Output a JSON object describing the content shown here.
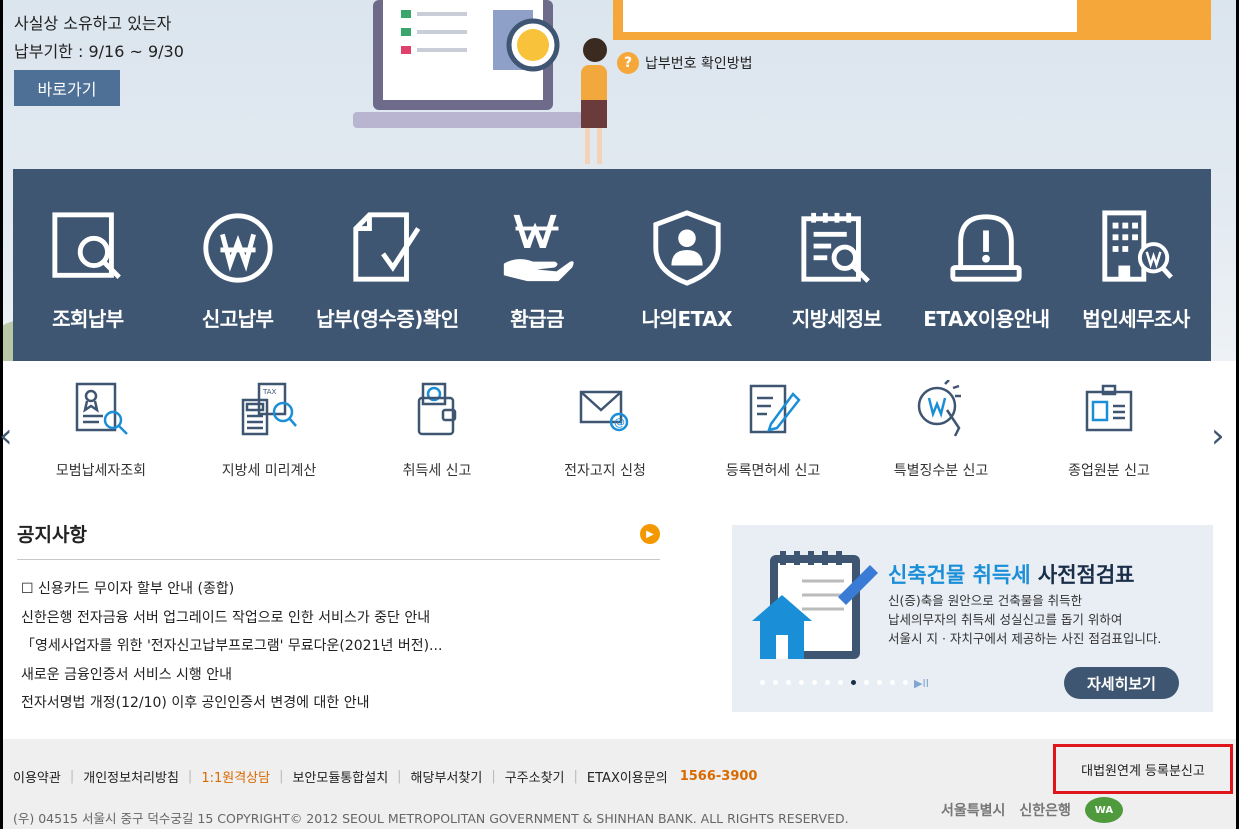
{
  "hero": {
    "line1": "사실상 소유하고 있는자",
    "line2": "납부기한 : 9/16 ~ 9/30",
    "button": "바로가기",
    "help": "납부번호 확인방법"
  },
  "main_menu": [
    {
      "label": "조회납부",
      "icon": "search-document-icon"
    },
    {
      "label": "신고납부",
      "icon": "won-coin-icon"
    },
    {
      "label": "납부(영수증)확인",
      "icon": "document-check-icon"
    },
    {
      "label": "환급금",
      "icon": "refund-hand-icon"
    },
    {
      "label": "나의ETAX",
      "icon": "user-shield-icon"
    },
    {
      "label": "지방세정보",
      "icon": "info-document-icon"
    },
    {
      "label": "ETAX이용안내",
      "icon": "alert-bell-icon"
    },
    {
      "label": "법인세무조사",
      "icon": "building-won-icon"
    }
  ],
  "sub_menu": [
    {
      "label": "모범납세자조회",
      "icon": "award-search-icon"
    },
    {
      "label": "지방세 미리계산",
      "icon": "calculator-icon"
    },
    {
      "label": "취득세 신고",
      "icon": "wallet-icon"
    },
    {
      "label": "전자고지 신청",
      "icon": "email-icon"
    },
    {
      "label": "등록면허세 신고",
      "icon": "form-pen-icon"
    },
    {
      "label": "특별징수분 신고",
      "icon": "won-touch-icon"
    },
    {
      "label": "종업원분 신고",
      "icon": "id-card-icon"
    }
  ],
  "notice": {
    "title": "공지사항",
    "items": [
      "☐ 신용카드 무이자 할부 안내 (종합)",
      "신한은행 전자금융 서버 업그레이드 작업으로 인한 서비스가 중단 안내",
      "「영세사업자를 위한 '전자신고납부프로그램' 무료다운(2021년 버전)...",
      "새로운 금융인증서 서비스 시행 안내",
      "전자서명법 개정(12/10) 이후 공인인증서 변경에 대한 안내"
    ]
  },
  "banner": {
    "title_highlight": "신축건물 취득세",
    "title_rest": " 사전점검표",
    "desc1": "신(증)축을 원안으로 건축물을 취득한",
    "desc2": "납세의무자의 취득세 성실신고를 돕기 위하여",
    "desc3": "서울시 지 · 자치구에서 제공하는 사진 점검표입니다.",
    "button": "자세히보기",
    "play": "▶II"
  },
  "footer": {
    "links": [
      "이용약관",
      "개인정보처리방침",
      "1:1원격상담",
      "보안모듈통합설치",
      "해당부서찾기",
      "구주소찾기",
      "ETAX이용문의"
    ],
    "phone": "1566-3900",
    "court": "대법원연계 등록분신고",
    "copyright": "(우) 04515 서울시 중구 덕수궁길 15 COPYRIGHT© 2012 SEOUL METROPOLITAN GOVERNMENT & SHINHAN BANK. ALL RIGHTS RESERVED.",
    "logo_seoul": "서울특별시",
    "logo_bank": "신한은행",
    "logo_wa": "WA"
  },
  "colors": {
    "navy": "#3f5672",
    "orange": "#f6a73a",
    "highlight_red": "#e0141b"
  }
}
